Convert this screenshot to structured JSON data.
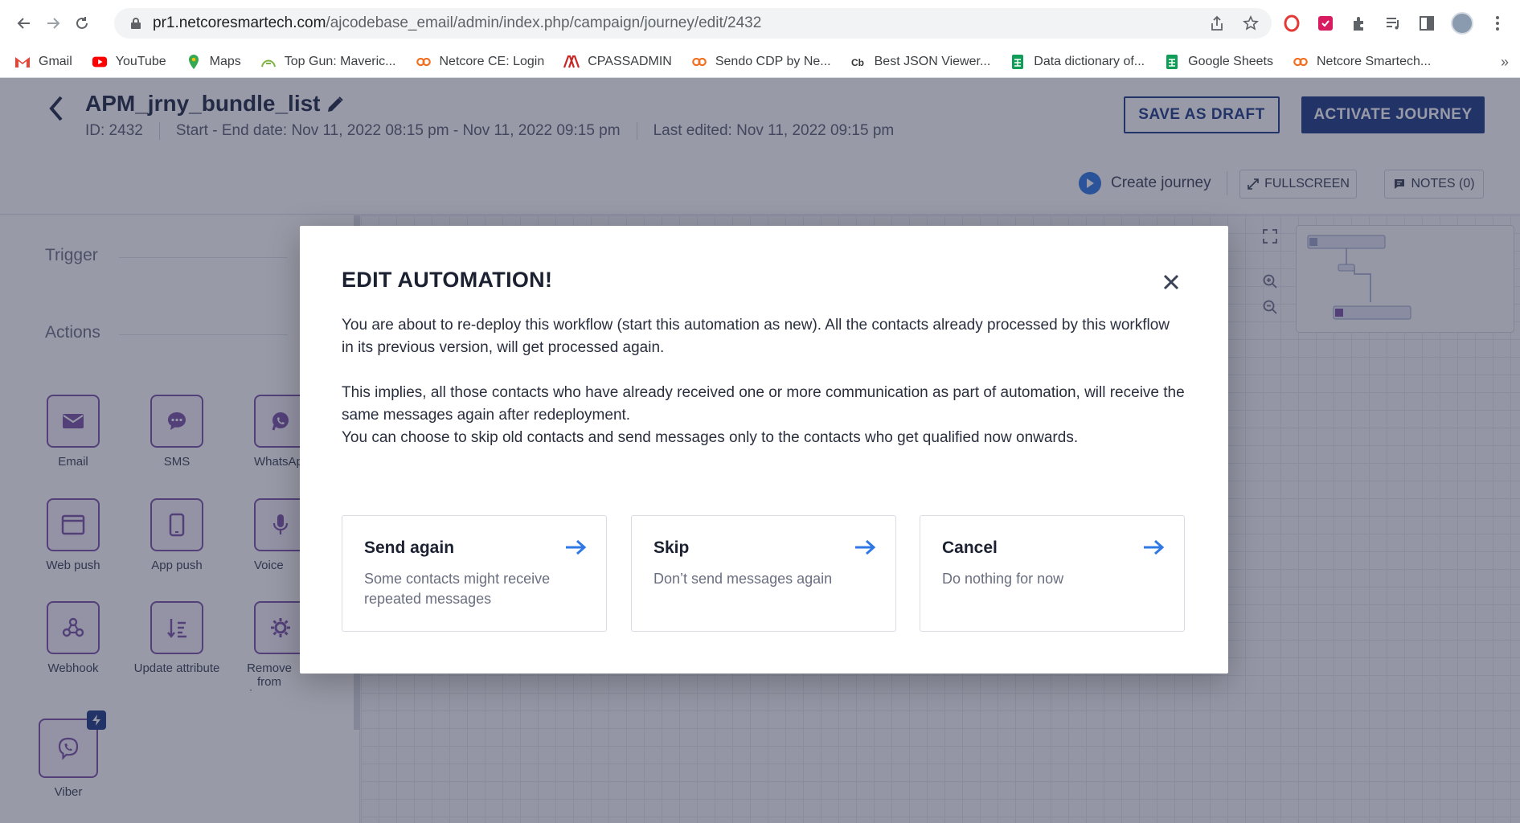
{
  "browser": {
    "url_host": "pr1.netcoresmartech.com",
    "url_path": "/ajcodebase_email/admin/index.php/campaign/journey/edit/2432",
    "bookmarks": [
      {
        "label": "Gmail",
        "icon": "gmail-icon",
        "color": "#ea4335"
      },
      {
        "label": "YouTube",
        "icon": "youtube-icon",
        "color": "#ff0000"
      },
      {
        "label": "Maps",
        "icon": "maps-icon",
        "color": "#34a853"
      },
      {
        "label": "Top Gun: Maveric...",
        "icon": "movie-icon",
        "color": "#7cb342"
      },
      {
        "label": "Netcore CE: Login",
        "icon": "netcore-icon",
        "color": "#f26f21"
      },
      {
        "label": "CPASSADMIN",
        "icon": "cpass-icon",
        "color": "#c62828"
      },
      {
        "label": "Sendo CDP by Ne...",
        "icon": "netcore-icon",
        "color": "#f26f21"
      },
      {
        "label": "Best JSON Viewer...",
        "icon": "cb-icon",
        "color": "#333333"
      },
      {
        "label": "Data dictionary of...",
        "icon": "sheets-icon",
        "color": "#0f9d58"
      },
      {
        "label": "Google Sheets",
        "icon": "sheets-icon",
        "color": "#0f9d58"
      },
      {
        "label": "Netcore Smartech...",
        "icon": "netcore-icon",
        "color": "#f26f21"
      }
    ],
    "bookmarks_more": "»"
  },
  "header": {
    "title": "APM_jrny_bundle_list",
    "id": "ID: 2432",
    "dates": "Start - End date: Nov 11, 2022 08:15 pm - Nov 11, 2022 09:15 pm",
    "last_edited": "Last edited: Nov 11, 2022 09:15 pm",
    "save_draft": "SAVE AS DRAFT",
    "activate": "ACTIVATE JOURNEY",
    "create_journey": "Create journey",
    "fullscreen": "FULLSCREEN",
    "notes": "NOTES (0)"
  },
  "sidebar": {
    "trigger_title": "Trigger",
    "actions_title": "Actions",
    "actions": [
      {
        "label": "Email",
        "icon": "email-icon"
      },
      {
        "label": "SMS",
        "icon": "sms-icon"
      },
      {
        "label": "WhatsApp",
        "icon": "whatsapp-icon"
      },
      {
        "label": "Web push",
        "icon": "web-push-icon"
      },
      {
        "label": "App push",
        "icon": "app-push-icon"
      },
      {
        "label": "Voice",
        "icon": "voice-icon"
      },
      {
        "label": "Webhook",
        "icon": "webhook-icon"
      },
      {
        "label": "Update attribute",
        "icon": "update-attribute-icon"
      },
      {
        "label": "Remove from journey",
        "icon": "remove-journey-icon"
      },
      {
        "label": "Viber",
        "icon": "viber-icon"
      }
    ]
  },
  "modal": {
    "title": "EDIT AUTOMATION!",
    "para1": "You are about to re-deploy this workflow (start this automation as new). All the contacts already processed by this workflow in its previous version, will get processed again.",
    "para2": "This implies, all those contacts who have already received one or more communication as part of automation, will receive the same messages again after redeployment.",
    "para3": "You can choose to skip old contacts and send messages only to the contacts who get qualified now onwards.",
    "options": [
      {
        "title": "Send again",
        "desc": "Some contacts might receive repeated messages"
      },
      {
        "title": "Skip",
        "desc": "Don’t send messages again"
      },
      {
        "title": "Cancel",
        "desc": "Do nothing for now"
      }
    ]
  },
  "colors": {
    "brand": "#1d3b85",
    "action_purple": "#7b53a8",
    "arrow_blue": "#2f78e5"
  }
}
